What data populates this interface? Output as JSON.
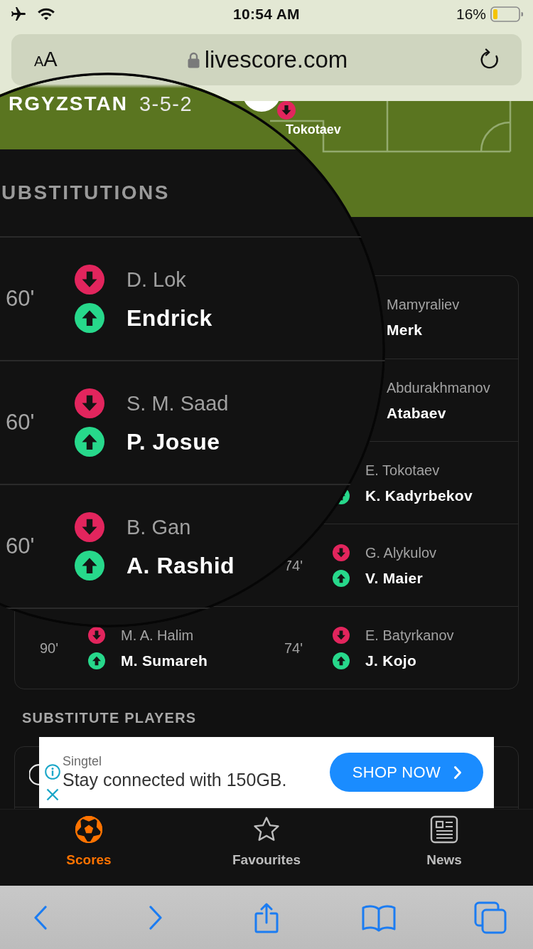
{
  "status_bar": {
    "time": "10:54 AM",
    "battery": "16%"
  },
  "address_bar": {
    "text_size": "AA",
    "url": "livescore.com"
  },
  "pitch": {
    "player_label": "Tokotaev"
  },
  "magnifier": {
    "team": "RGYZSTAN",
    "formation": "3-5-2",
    "section_title": "UBSTITUTIONS",
    "substitutions": [
      {
        "minute": "60'",
        "player_out": "D. Lok",
        "player_in": "Endrick"
      },
      {
        "minute": "60'",
        "player_out": "S. M. Saad",
        "player_in": "P. Josue"
      },
      {
        "minute": "60'",
        "player_out": "B. Gan",
        "player_in": "A. Rashid"
      }
    ]
  },
  "substitutions": {
    "rows": [
      {
        "right": {
          "kind": "covered",
          "player_out": "Mamyraliev",
          "player_in": "Merk"
        }
      },
      {
        "right": {
          "kind": "covered",
          "player_out": "Abdurakhmanov",
          "player_in": "Atabaev"
        }
      },
      {
        "right": {
          "kind": "partial",
          "player_out": "E. Tokotaev",
          "player_in": "K. Kadyrbekov"
        }
      },
      {
        "right": {
          "kind": "full",
          "minute": "74'",
          "player_out": "G. Alykulov",
          "player_in": "V. Maier"
        }
      },
      {
        "left": {
          "kind": "full",
          "minute": "90'",
          "player_out": "M. A. Halim",
          "player_in": "M. Sumareh"
        },
        "right": {
          "kind": "full",
          "minute": "74'",
          "player_out": "E. Batyrkanov",
          "player_in": "J. Kojo"
        }
      }
    ]
  },
  "substitute_players": {
    "title": "SUBSTITUTE PLAYERS"
  },
  "ad": {
    "advertiser": "Singtel",
    "text": "Stay connected with 150GB.",
    "button": "SHOP NOW"
  },
  "tab_bar": [
    {
      "label": "Scores",
      "selected": true
    },
    {
      "label": "Favourites",
      "selected": false
    },
    {
      "label": "News",
      "selected": false
    }
  ]
}
